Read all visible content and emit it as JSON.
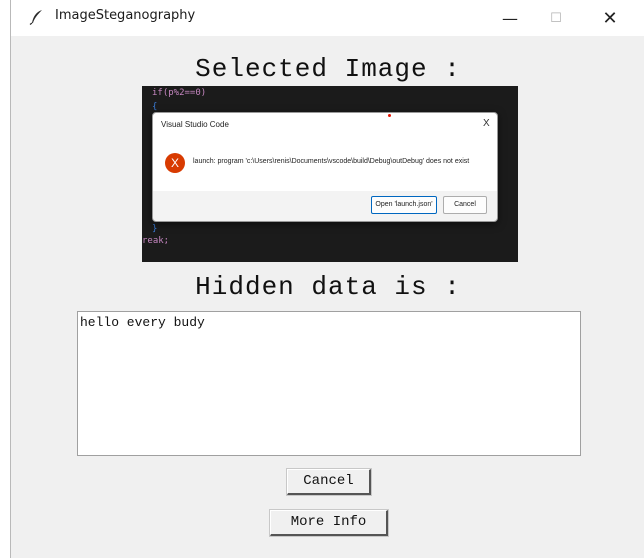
{
  "window": {
    "title": "ImageSteganography",
    "minimize_glyph": "—",
    "maximize_glyph": "☐",
    "close_glyph": "✕",
    "icon": "feather-icon"
  },
  "main": {
    "selected_heading": "Selected Image :",
    "hidden_heading": "Hidden data is :",
    "hidden_text": "hello every budy",
    "cancel_label": "Cancel",
    "more_info_label": "More Info"
  },
  "image": {
    "code_top": "if(p%2==0)",
    "code_bottom": "reak;",
    "dialog": {
      "title": "Visual Studio Code",
      "close_glyph": "X",
      "error_glyph": "X",
      "message": "launch: program 'c:\\Users\\renis\\Documents\\vscode\\build\\Debug\\outDebug' does not exist",
      "open_label": "Open 'launch.json'",
      "cancel_label": "Cancel"
    }
  },
  "colors": {
    "window_bg": "#f0f0f0",
    "error_red": "#d83b01",
    "accent_blue": "#0067c0"
  }
}
